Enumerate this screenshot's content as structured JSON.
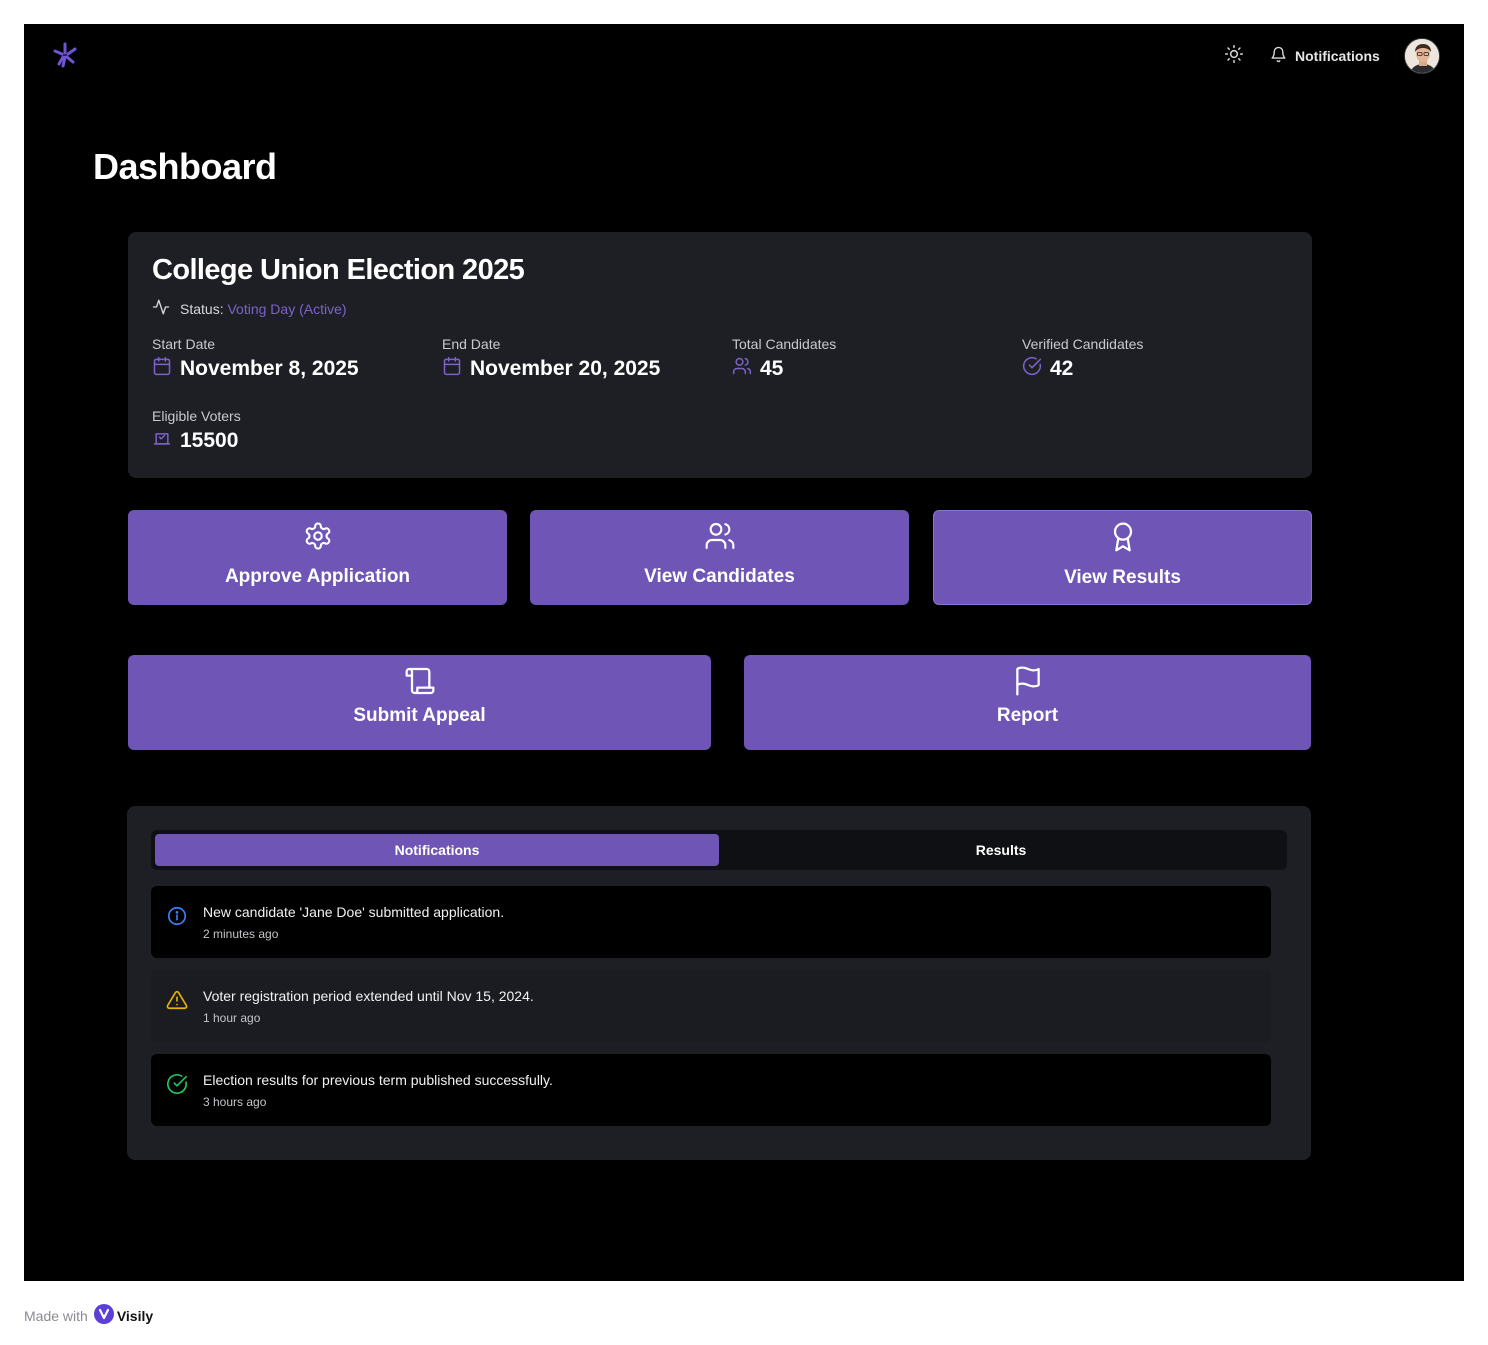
{
  "header": {
    "notifications_label": "Notifications"
  },
  "page": {
    "title": "Dashboard"
  },
  "election": {
    "title": "College Union Election 2025",
    "status_label": "Status:",
    "status_value": "Voting Day (Active)",
    "stats": {
      "start_date": {
        "label": "Start Date",
        "value": "November 8, 2025"
      },
      "end_date": {
        "label": "End Date",
        "value": "November 20, 2025"
      },
      "total_candidates": {
        "label": "Total Candidates",
        "value": "45"
      },
      "verified_candidates": {
        "label": "Verified Candidates",
        "value": "42"
      },
      "eligible_voters": {
        "label": "Eligible Voters",
        "value": "15500"
      }
    }
  },
  "actions": {
    "approve": "Approve Application",
    "candidates": "View Candidates",
    "results": "View Results",
    "appeal": "Submit Appeal",
    "report": "Report"
  },
  "tabs": {
    "notifications": "Notifications",
    "results": "Results"
  },
  "notifications": [
    {
      "text": "New candidate 'Jane Doe' submitted application.",
      "time": "2 minutes ago",
      "icon": "info-icon",
      "color": "#3b82f6"
    },
    {
      "text": "Voter registration period extended until Nov 15, 2024.",
      "time": "1 hour ago",
      "icon": "warning-icon",
      "color": "#eab308"
    },
    {
      "text": "Election results for previous term published successfully.",
      "time": "3 hours ago",
      "icon": "check-circle-icon",
      "color": "#22c55e"
    }
  ],
  "footer": {
    "made_with": "Made with",
    "brand": "Visily"
  },
  "colors": {
    "accent": "#6f55b6",
    "card": "#1d1f25",
    "background": "#000000"
  }
}
